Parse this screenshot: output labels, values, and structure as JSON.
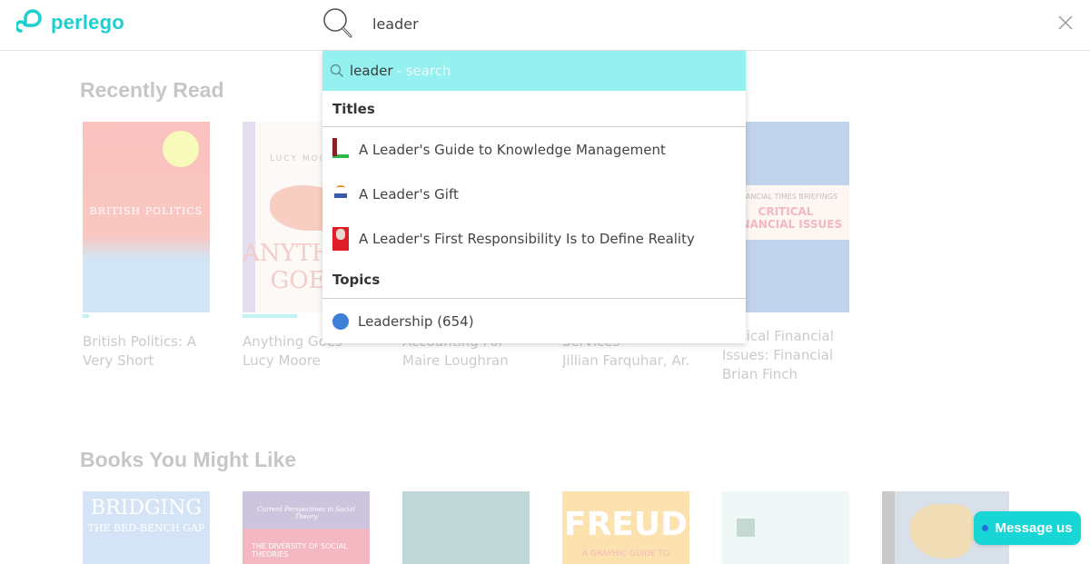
{
  "app": {
    "brand": "perlego",
    "brand_color": "#1dcfcf"
  },
  "search": {
    "value": "leader",
    "placeholder": "",
    "icon": "search-icon",
    "close_icon": "close-icon"
  },
  "dropdown": {
    "suggestion": {
      "query": "leader",
      "hint": " - search",
      "icon": "search-icon"
    },
    "titles_heading": "Titles",
    "titles": [
      {
        "label": "A Leader's Guide to Knowledge Management"
      },
      {
        "label": "A Leader's Gift"
      },
      {
        "label": "A Leader's First Responsibility Is to Define Reality"
      }
    ],
    "topics_heading": "Topics",
    "topics": [
      {
        "label": "Leadership (654)",
        "color": "#3d80d6"
      }
    ]
  },
  "recently_read": {
    "title": "Recently Read",
    "books": [
      {
        "title": "British Politics: A",
        "title2": "Very Short",
        "author": "",
        "cover_text": "BRITISH POLITICS",
        "progress": 0.05
      },
      {
        "title": "Anything Goes",
        "author": "Lucy Moore",
        "cover_text": "ANYTHING GOES",
        "cover_author": "LUCY MOORE",
        "progress": 0.43
      },
      {
        "title": "Accounting For",
        "author": "Maire Loughran",
        "progress": 0
      },
      {
        "title": "Services",
        "author": "Jillian Farquhar, Ar...",
        "progress": 0
      },
      {
        "title": "Critical Financial",
        "title2": "Issues: Financial",
        "author": "Brian Finch",
        "cover_text": "FINANCIAL TIMES BRIEFINGS",
        "cover_text2": "CRITICAL FINANCIAL ISSUES",
        "progress": 0
      }
    ]
  },
  "books_you_might_like": {
    "title": "Books You Might Like",
    "books": [
      {
        "cover_text": "BRIDGING",
        "cover_text2": "THE BED-BENCH GAP"
      },
      {
        "cover_text": "Current Perspectives in Social Theory",
        "cover_text2": "THE DIVERSITY OF SOCIAL THEORIES"
      },
      {
        "cover_text": ""
      },
      {
        "cover_text": "FREUD",
        "cover_text2": "A GRAPHIC GUIDE TO"
      },
      {
        "cover_text": ""
      },
      {
        "cover_text": ""
      }
    ]
  },
  "chat": {
    "label": "Message us"
  }
}
